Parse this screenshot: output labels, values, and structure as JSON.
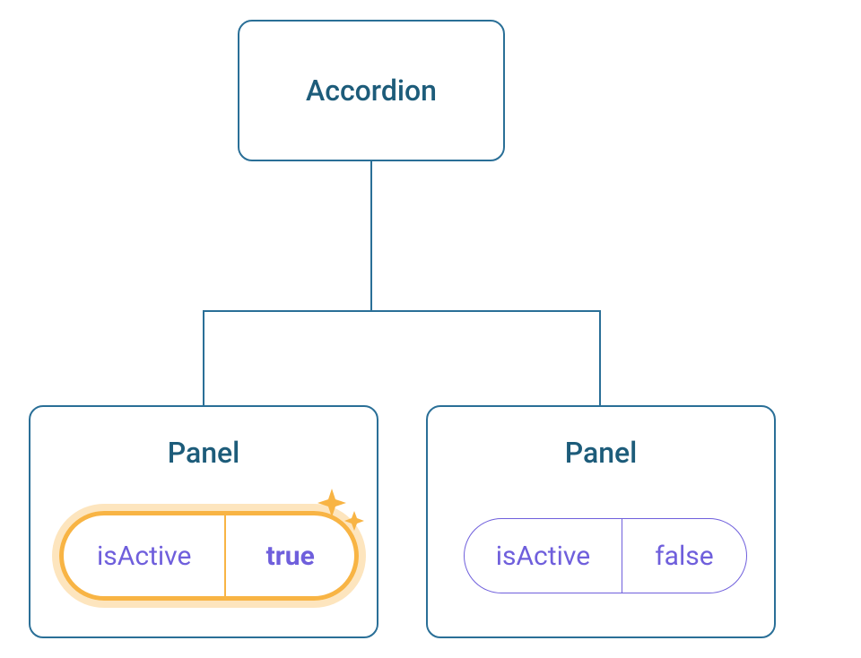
{
  "diagram": {
    "root": {
      "label": "Accordion"
    },
    "children": [
      {
        "label": "Panel",
        "state": {
          "key": "isActive",
          "value": "true",
          "highlighted": true
        }
      },
      {
        "label": "Panel",
        "state": {
          "key": "isActive",
          "value": "false",
          "highlighted": false
        }
      }
    ]
  },
  "colors": {
    "border": "#2a6f97",
    "title": "#1d5c7a",
    "prop": "#6f5fdc",
    "highlight": "#f8b444"
  }
}
